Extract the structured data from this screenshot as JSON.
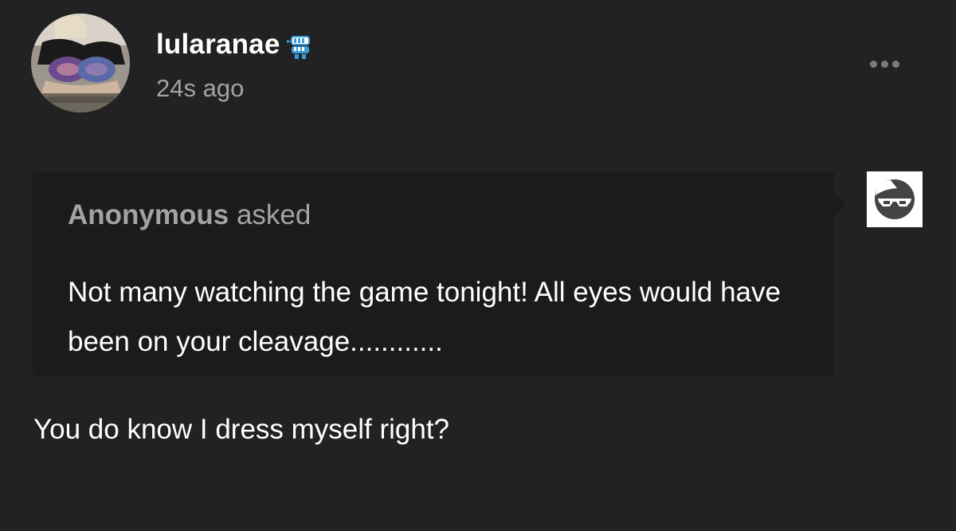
{
  "post": {
    "username": "lularanae",
    "timestamp": "24s ago",
    "badge_icon": "blue-chattering-teeth-icon",
    "more_icon": "more-options-ellipsis-icon"
  },
  "ask": {
    "asker": "Anonymous",
    "asked_label": " asked",
    "question": "Not many watching the game tonight! All eyes would have been on your cleavage............",
    "asker_avatar_icon": "sunglasses-face-icon"
  },
  "answer": {
    "text": "You do know I dress myself right?"
  },
  "colors": {
    "background": "#222222",
    "ask_box": "#1b1b1b",
    "muted_text": "#a3a3a3",
    "text": "#ffffff",
    "badge_blue": "#3b9bd6"
  }
}
